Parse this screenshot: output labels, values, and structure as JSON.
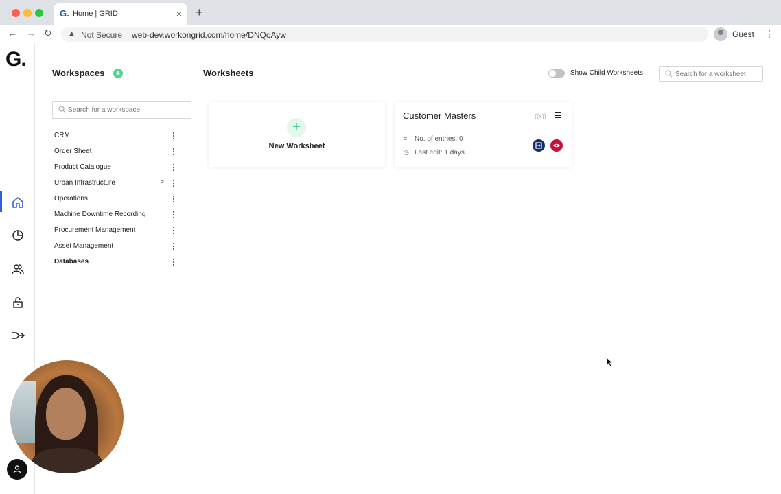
{
  "browser": {
    "tab_favicon": "G.",
    "tab_title": "Home | GRID",
    "security_label": "Not Secure",
    "url": "web-dev.workongrid.com/home/DNQoAyw",
    "profile_label": "Guest"
  },
  "app": {
    "logo": "G.",
    "rail_icons": [
      "home-icon",
      "analytics-pie-icon",
      "users-icon",
      "unlock-icon",
      "integrations-icon"
    ],
    "active_rail_item": "home",
    "accent_color": "#2f5ee0"
  },
  "workspaces": {
    "title": "Workspaces",
    "search_placeholder": "Search for a workspace",
    "items": [
      {
        "label": "CRM",
        "has_children": false,
        "bold": false
      },
      {
        "label": "Order Sheet",
        "has_children": false,
        "bold": false
      },
      {
        "label": "Product Catalogue",
        "has_children": false,
        "bold": false
      },
      {
        "label": "Urban Infrastructure",
        "has_children": true,
        "chevron": ">",
        "bold": false
      },
      {
        "label": "Operations",
        "has_children": false,
        "bold": false
      },
      {
        "label": "Machine Downtime Recording",
        "has_children": false,
        "bold": false
      },
      {
        "label": "Procurement Management",
        "has_children": false,
        "bold": false
      },
      {
        "label": "Asset Management",
        "has_children": false,
        "bold": false
      },
      {
        "label": "Databases",
        "has_children": false,
        "bold": true
      }
    ]
  },
  "worksheets": {
    "title": "Worksheets",
    "toggle_label": "Show Child Worksheets",
    "toggle_on": false,
    "search_placeholder": "Search for a worksheet",
    "new_card": {
      "label": "New Worksheet"
    },
    "cards": [
      {
        "title": "Customer Masters",
        "entries_text": "No. of entries: 0",
        "last_edit_text": "Last edit: 1 days",
        "open_button_color": "#11306b",
        "view_button_color": "#c8103e"
      }
    ]
  }
}
